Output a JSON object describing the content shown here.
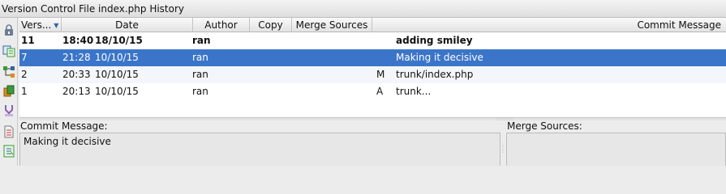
{
  "window": {
    "title": "Version Control File index.php History"
  },
  "toolbar": {
    "buttons": [
      {
        "name": "lock-icon"
      },
      {
        "name": "compare-revisions-icon"
      },
      {
        "name": "graph-icon"
      },
      {
        "name": "copy-revision-icon"
      },
      {
        "name": "merge-icon"
      },
      {
        "name": "document-icon"
      },
      {
        "name": "annotate-icon"
      }
    ],
    "colors": {
      "blue": "#3465a4",
      "green": "#3a9a3a",
      "orange": "#e08a1e",
      "purple": "#8a5fb5"
    }
  },
  "table": {
    "columns": {
      "version": "Vers...",
      "date": "Date",
      "author": "Author",
      "copy": "Copy",
      "merge_sources": "Merge Sources",
      "commit_message": "Commit Message"
    },
    "sort_icon": "sort-descending-icon",
    "rows": [
      {
        "version": "11",
        "time": "18:40",
        "date": "18/10/15",
        "author": "ran",
        "flag": "",
        "message": "adding smiley"
      },
      {
        "version": "7",
        "time": "21:28",
        "date": "10/10/15",
        "author": "ran",
        "flag": "",
        "message": "Making it decisive"
      },
      {
        "version": "2",
        "time": "20:33",
        "date": "10/10/15",
        "author": "ran",
        "flag": "M",
        "message": "trunk/index.php"
      },
      {
        "version": "1",
        "time": "20:13",
        "date": "10/10/15",
        "author": "ran",
        "flag": "A",
        "message": "trunk..."
      }
    ],
    "selected_row": 1,
    "selection_color": "#3b75c9"
  },
  "details": {
    "commit_message_label": "Commit Message:",
    "commit_message_value": "Making it decisive",
    "merge_sources_label": "Merge Sources:",
    "merge_sources_value": ""
  }
}
